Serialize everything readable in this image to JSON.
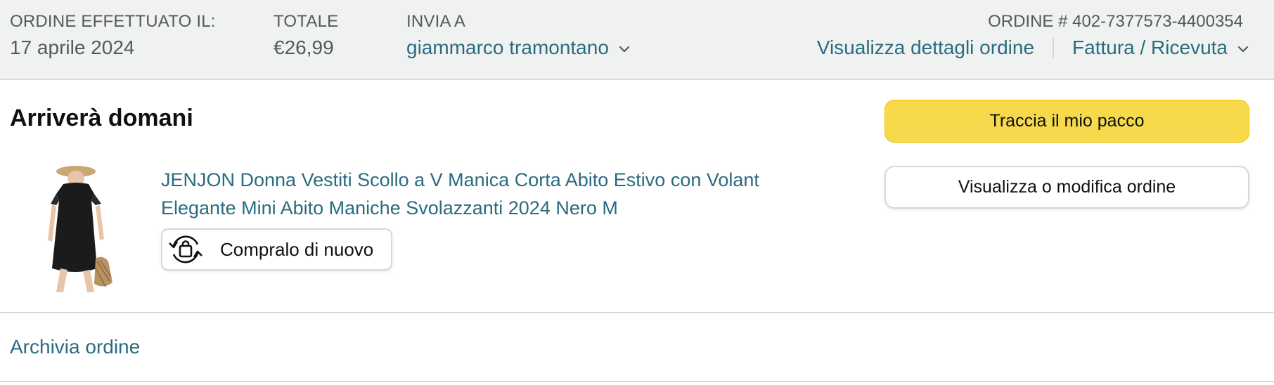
{
  "header": {
    "order_placed": {
      "label": "ORDINE EFFETTUATO IL:",
      "value": "17 aprile 2024"
    },
    "total": {
      "label": "TOTALE",
      "value": "€26,99"
    },
    "ship_to": {
      "label": "INVIA A",
      "value": "giammarco tramontano"
    },
    "order_number": "ORDINE # 402-7377573-4400354",
    "view_details": "Visualizza dettagli ordine",
    "invoice": "Fattura / Ricevuta"
  },
  "shipment": {
    "status": "Arriverà domani",
    "item": {
      "title": "JENJON Donna Vestiti Scollo a V Manica Corta Abito Estivo con Volant Elegante Mini Abito Maniche Svolazzanti 2024 Nero M",
      "buy_again": "Compralo di nuovo",
      "image_icon": "black-mini-dress-product-image"
    }
  },
  "actions": {
    "track": "Traccia il mio pacco",
    "view_modify": "Visualizza o modifica ordine"
  },
  "footer": {
    "archive": "Archivia ordine"
  },
  "colors": {
    "link": "#2a6b80",
    "primary_button": "#f7d94c",
    "header_bg": "#f0f2f2",
    "border": "#d5d9d9"
  }
}
